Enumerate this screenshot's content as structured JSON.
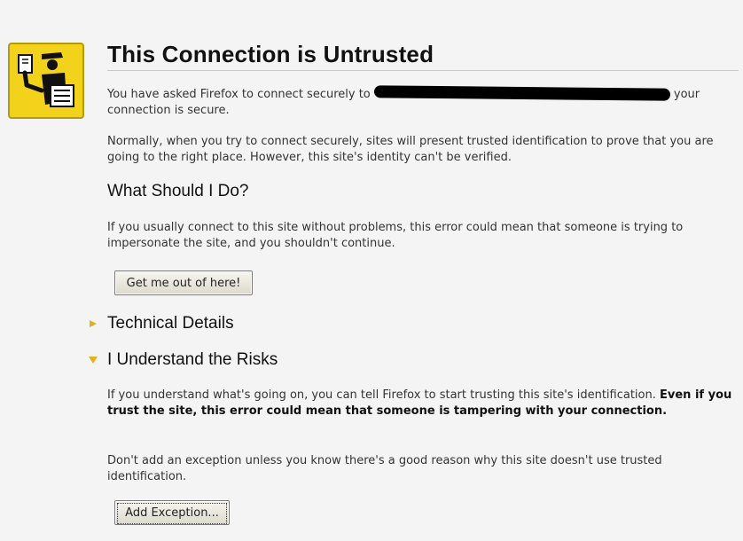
{
  "page": {
    "title": "This Connection is Untrusted",
    "intro_before": "You have asked Firefox to connect securely to",
    "intro_after": "your connection is secure.",
    "normally_text": "Normally, when you try to connect securely, sites will present trusted identification to prove that you are going to the right place. However, this site's identity can't be verified.",
    "what_heading": "What Should I Do?",
    "what_text": "If you usually connect to this site without problems, this error could mean that someone is trying to impersonate the site, and you shouldn't continue.",
    "get_out_button": "Get me out of here!",
    "technical_details": "Technical Details",
    "understand_risks": "I Understand the Risks",
    "risks_text": "If you understand what's going on, you can tell Firefox to start trusting this site's identification.",
    "risks_bold": "Even if you trust the site, this error could mean that someone is tampering with your connection.",
    "exception_text": "Don't add an exception unless you know there's a good reason why this site doesn't use trusted identification.",
    "add_exception_button": "Add Exception..."
  },
  "colors": {
    "icon_background": "#f3d21c",
    "expander_arrow": "#e0b020"
  },
  "icons": {
    "warning_badge": "officer-checkpoint-icon",
    "collapsed": "triangle-right-icon",
    "expanded": "triangle-down-icon"
  }
}
